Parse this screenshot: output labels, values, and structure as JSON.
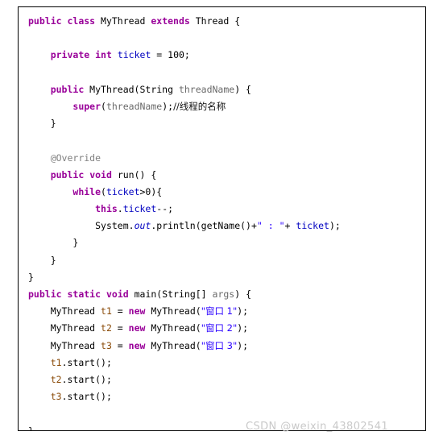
{
  "document": {
    "type": "java-code-listing",
    "language": "Java",
    "colors": {
      "background": "#ffffff",
      "border": "#000000",
      "keyword": "#990099",
      "field": "#0000c0",
      "string": "#2a00ff",
      "static_field": "#0000c0",
      "parameter": "#6a6a6a",
      "annotation": "#808080",
      "local_variable": "#8a4b08",
      "plain_text": "#000000",
      "watermark": "#c9c9c9"
    }
  },
  "code": {
    "lines": [
      {
        "indent": 0,
        "tokens": [
          {
            "t": "public",
            "c": "keyword"
          },
          {
            "t": " ",
            "c": "plain"
          },
          {
            "t": "class",
            "c": "keyword"
          },
          {
            "t": " MyThread ",
            "c": "plain"
          },
          {
            "t": "extends",
            "c": "keyword"
          },
          {
            "t": " Thread {",
            "c": "plain"
          }
        ]
      },
      {
        "indent": 0,
        "tokens": []
      },
      {
        "indent": 1,
        "tokens": [
          {
            "t": "private",
            "c": "keyword"
          },
          {
            "t": " ",
            "c": "plain"
          },
          {
            "t": "int",
            "c": "keyword"
          },
          {
            "t": " ",
            "c": "plain"
          },
          {
            "t": "ticket",
            "c": "field"
          },
          {
            "t": " = 100;",
            "c": "plain"
          }
        ]
      },
      {
        "indent": 0,
        "tokens": []
      },
      {
        "indent": 1,
        "tokens": [
          {
            "t": "public",
            "c": "keyword"
          },
          {
            "t": " MyThread(String ",
            "c": "plain"
          },
          {
            "t": "threadName",
            "c": "param"
          },
          {
            "t": ") {",
            "c": "plain"
          }
        ]
      },
      {
        "indent": 2,
        "tokens": [
          {
            "t": "super",
            "c": "keyword"
          },
          {
            "t": "(",
            "c": "plain"
          },
          {
            "t": "threadName",
            "c": "param"
          },
          {
            "t": ");",
            "c": "plain"
          },
          {
            "t": "//线程的名称",
            "c": "comment"
          }
        ]
      },
      {
        "indent": 1,
        "tokens": [
          {
            "t": "}",
            "c": "plain"
          }
        ]
      },
      {
        "indent": 0,
        "tokens": []
      },
      {
        "indent": 1,
        "tokens": [
          {
            "t": "@Override",
            "c": "annot"
          }
        ]
      },
      {
        "indent": 1,
        "tokens": [
          {
            "t": "public",
            "c": "keyword"
          },
          {
            "t": " ",
            "c": "plain"
          },
          {
            "t": "void",
            "c": "keyword"
          },
          {
            "t": " run() {",
            "c": "plain"
          }
        ]
      },
      {
        "indent": 2,
        "tokens": [
          {
            "t": "while",
            "c": "keyword"
          },
          {
            "t": "(",
            "c": "plain"
          },
          {
            "t": "ticket",
            "c": "field"
          },
          {
            "t": ">0){",
            "c": "plain"
          }
        ]
      },
      {
        "indent": 3,
        "tokens": [
          {
            "t": "this",
            "c": "keyword"
          },
          {
            "t": ".",
            "c": "plain"
          },
          {
            "t": "ticket",
            "c": "field"
          },
          {
            "t": "--;",
            "c": "plain"
          }
        ]
      },
      {
        "indent": 3,
        "tokens": [
          {
            "t": "System.",
            "c": "plain"
          },
          {
            "t": "out",
            "c": "static"
          },
          {
            "t": ".println(getName()+",
            "c": "plain"
          },
          {
            "t": "\" : \"",
            "c": "string"
          },
          {
            "t": "+ ",
            "c": "plain"
          },
          {
            "t": "ticket",
            "c": "field"
          },
          {
            "t": ");",
            "c": "plain"
          }
        ]
      },
      {
        "indent": 2,
        "tokens": [
          {
            "t": "}",
            "c": "plain"
          }
        ]
      },
      {
        "indent": 1,
        "tokens": [
          {
            "t": "}",
            "c": "plain"
          }
        ]
      },
      {
        "indent": 0,
        "tokens": [
          {
            "t": "}",
            "c": "plain"
          }
        ]
      },
      {
        "indent": 0,
        "tokens": [
          {
            "t": "public",
            "c": "keyword"
          },
          {
            "t": " ",
            "c": "plain"
          },
          {
            "t": "static",
            "c": "keyword"
          },
          {
            "t": " ",
            "c": "plain"
          },
          {
            "t": "void",
            "c": "keyword"
          },
          {
            "t": " main(String[] ",
            "c": "plain"
          },
          {
            "t": "args",
            "c": "param"
          },
          {
            "t": ") {",
            "c": "plain"
          }
        ]
      },
      {
        "indent": 1,
        "tokens": [
          {
            "t": "MyThread ",
            "c": "plain"
          },
          {
            "t": "t1",
            "c": "local"
          },
          {
            "t": " = ",
            "c": "plain"
          },
          {
            "t": "new",
            "c": "keyword"
          },
          {
            "t": " MyThread(",
            "c": "plain"
          },
          {
            "t": "\"窗口 1\"",
            "c": "string"
          },
          {
            "t": ");",
            "c": "plain"
          }
        ]
      },
      {
        "indent": 1,
        "tokens": [
          {
            "t": "MyThread ",
            "c": "plain"
          },
          {
            "t": "t2",
            "c": "local"
          },
          {
            "t": " = ",
            "c": "plain"
          },
          {
            "t": "new",
            "c": "keyword"
          },
          {
            "t": " MyThread(",
            "c": "plain"
          },
          {
            "t": "\"窗口 2\"",
            "c": "string"
          },
          {
            "t": ");",
            "c": "plain"
          }
        ]
      },
      {
        "indent": 1,
        "tokens": [
          {
            "t": "MyThread ",
            "c": "plain"
          },
          {
            "t": "t3",
            "c": "local"
          },
          {
            "t": " = ",
            "c": "plain"
          },
          {
            "t": "new",
            "c": "keyword"
          },
          {
            "t": " MyThread(",
            "c": "plain"
          },
          {
            "t": "\"窗口 3\"",
            "c": "string"
          },
          {
            "t": ");",
            "c": "plain"
          }
        ]
      },
      {
        "indent": 1,
        "tokens": [
          {
            "t": "t1",
            "c": "local"
          },
          {
            "t": ".start();",
            "c": "plain"
          }
        ]
      },
      {
        "indent": 1,
        "tokens": [
          {
            "t": "t2",
            "c": "local"
          },
          {
            "t": ".start();",
            "c": "plain"
          }
        ]
      },
      {
        "indent": 1,
        "tokens": [
          {
            "t": "t3",
            "c": "local"
          },
          {
            "t": ".start();",
            "c": "plain"
          }
        ]
      },
      {
        "indent": 0,
        "tokens": []
      },
      {
        "indent": 0,
        "tokens": [
          {
            "t": "}",
            "c": "plain"
          }
        ]
      }
    ]
  },
  "watermark": {
    "text": "CSDN @weixin_43802541"
  }
}
